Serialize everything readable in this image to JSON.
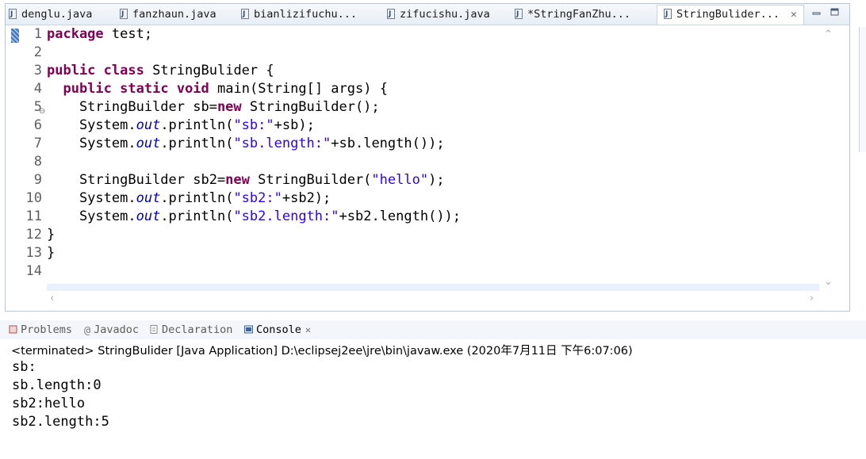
{
  "editor": {
    "tabs": [
      {
        "label": "denglu.java"
      },
      {
        "label": "fanzhaun.java"
      },
      {
        "label": "bianlizifuchu..."
      },
      {
        "label": "zifucishu.java"
      },
      {
        "label": "*StringFanZhu..."
      },
      {
        "label": "StringBulider...",
        "active": true
      }
    ],
    "close_glyph": "✕",
    "line_numbers": [
      "1",
      "2",
      "3",
      "4",
      "5",
      "6",
      "7",
      "8",
      "9",
      "10",
      "11",
      "12",
      "13",
      "14"
    ],
    "code_lines": [
      {
        "parts": [
          {
            "t": "package",
            "c": "kw"
          },
          {
            "t": " test;",
            "c": ""
          }
        ]
      },
      {
        "parts": []
      },
      {
        "parts": [
          {
            "t": "public",
            "c": "kw"
          },
          {
            "t": " ",
            "c": ""
          },
          {
            "t": "class",
            "c": "kw"
          },
          {
            "t": " StringBulider {",
            "c": ""
          }
        ]
      },
      {
        "parts": [
          {
            "t": "  ",
            "c": ""
          },
          {
            "t": "public",
            "c": "kw"
          },
          {
            "t": " ",
            "c": ""
          },
          {
            "t": "static",
            "c": "kw"
          },
          {
            "t": " ",
            "c": ""
          },
          {
            "t": "void",
            "c": "kw"
          },
          {
            "t": " main(String[] args) {",
            "c": ""
          }
        ]
      },
      {
        "parts": [
          {
            "t": "    StringBuilder sb=",
            "c": ""
          },
          {
            "t": "new",
            "c": "kw"
          },
          {
            "t": " StringBuilder();",
            "c": ""
          }
        ]
      },
      {
        "parts": [
          {
            "t": "    System.",
            "c": ""
          },
          {
            "t": "out",
            "c": "fld"
          },
          {
            "t": ".println(",
            "c": ""
          },
          {
            "t": "\"sb:\"",
            "c": "str"
          },
          {
            "t": "+sb);",
            "c": ""
          }
        ]
      },
      {
        "parts": [
          {
            "t": "    System.",
            "c": ""
          },
          {
            "t": "out",
            "c": "fld"
          },
          {
            "t": ".println(",
            "c": ""
          },
          {
            "t": "\"sb.length:\"",
            "c": "str"
          },
          {
            "t": "+sb.length());",
            "c": ""
          }
        ]
      },
      {
        "parts": []
      },
      {
        "parts": [
          {
            "t": "    StringBuilder sb2=",
            "c": ""
          },
          {
            "t": "new",
            "c": "kw"
          },
          {
            "t": " StringBuilder(",
            "c": ""
          },
          {
            "t": "\"hello\"",
            "c": "str"
          },
          {
            "t": ");",
            "c": ""
          }
        ]
      },
      {
        "parts": [
          {
            "t": "    System.",
            "c": ""
          },
          {
            "t": "out",
            "c": "fld"
          },
          {
            "t": ".println(",
            "c": ""
          },
          {
            "t": "\"sb2:\"",
            "c": "str"
          },
          {
            "t": "+sb2);",
            "c": ""
          }
        ]
      },
      {
        "parts": [
          {
            "t": "    System.",
            "c": ""
          },
          {
            "t": "out",
            "c": "fld"
          },
          {
            "t": ".println(",
            "c": ""
          },
          {
            "t": "\"sb2.length:\"",
            "c": "str"
          },
          {
            "t": "+sb2.length());",
            "c": ""
          }
        ]
      },
      {
        "parts": [
          {
            "t": "}",
            "c": ""
          }
        ]
      },
      {
        "parts": [
          {
            "t": "}",
            "c": ""
          }
        ]
      },
      {
        "parts": []
      }
    ],
    "fold_glyph": "⊖"
  },
  "panel": {
    "tabs": [
      {
        "label": "Problems",
        "icon": "problems-icon"
      },
      {
        "label": "Javadoc",
        "icon": "at-icon"
      },
      {
        "label": "Declaration",
        "icon": "declaration-icon"
      },
      {
        "label": "Console",
        "icon": "console-icon",
        "active": true
      }
    ],
    "console_header": "<terminated> StringBulider [Java Application] D:\\eclipsej2ee\\jre\\bin\\javaw.exe (2020年7月11日 下午6:07:06)",
    "output_lines": [
      "sb:",
      "sb.length:0",
      "sb2:hello",
      "sb2.length:5"
    ]
  },
  "colors": {
    "keyword": "#7f0055",
    "string": "#2a00ff",
    "field": "#0000c0",
    "current_line": "#e8f2fe"
  }
}
